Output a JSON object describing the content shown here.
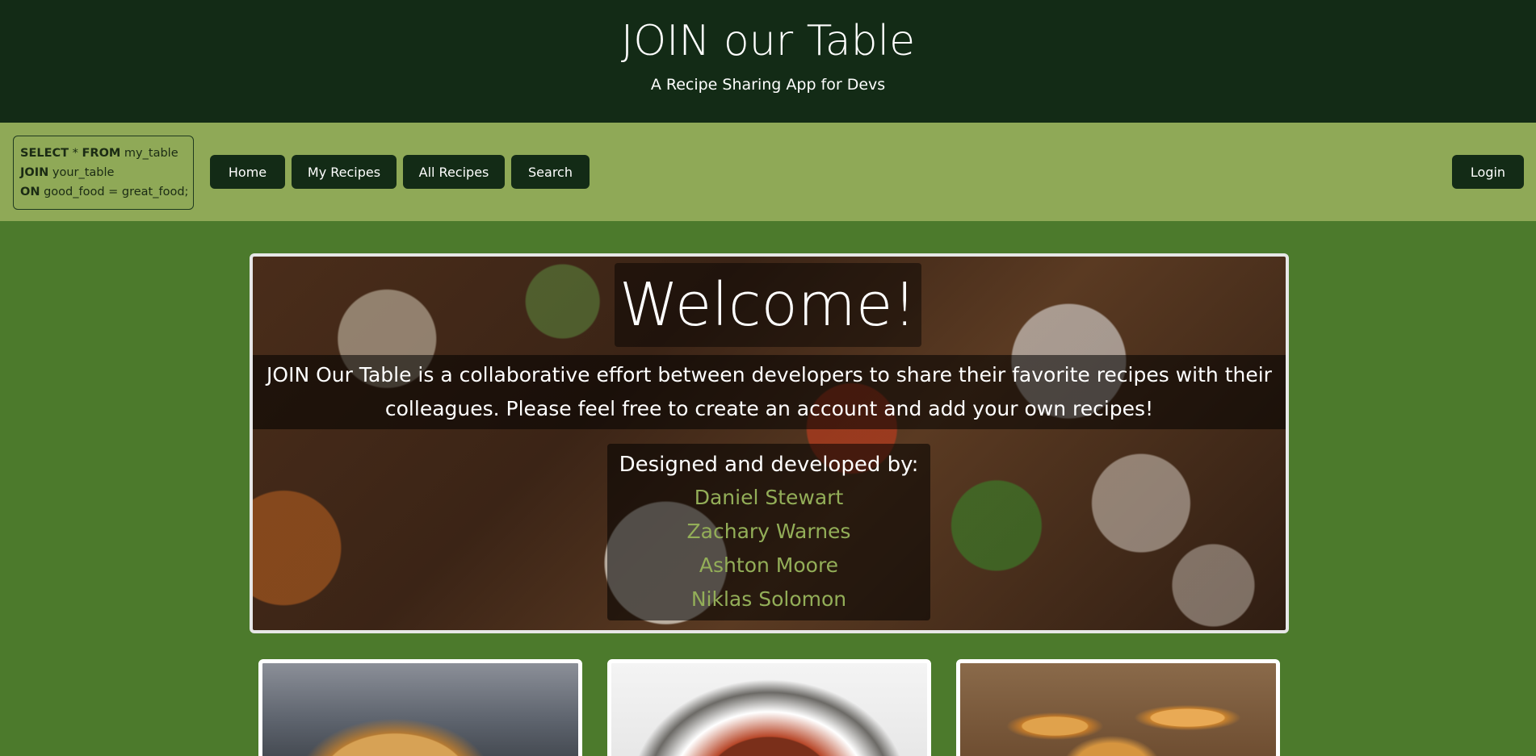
{
  "header": {
    "title": "JOIN our Table",
    "subtitle": "A Recipe Sharing App for Devs"
  },
  "logo": {
    "line1_kw": "SELECT",
    "line1_mid": " * ",
    "line1_kw2": "FROM",
    "line1_rest": " my_table",
    "line2_kw": "JOIN",
    "line2_rest": " your_table",
    "line3_kw": "ON",
    "line3_rest": " good_food = great_food;"
  },
  "nav": {
    "home": "Home",
    "my_recipes": "My Recipes",
    "all_recipes": "All Recipes",
    "search": "Search",
    "login": "Login"
  },
  "hero": {
    "welcome": "Welcome!",
    "description": "JOIN Our Table is a collaborative effort between developers to share their favorite recipes with their colleagues. Please feel free to create an account and add your own recipes!",
    "devs_heading": "Designed and developed by:",
    "developers": [
      "Daniel Stewart",
      "Zachary Warnes",
      "Ashton Moore",
      "Niklas Solomon"
    ]
  },
  "cards": [
    {
      "image": "pancakes-photo"
    },
    {
      "image": "bowl-photo"
    },
    {
      "image": "roast-chicken-photo"
    }
  ],
  "colors": {
    "header_bg": "#132b16",
    "nav_bg": "#8fa957",
    "page_bg": "#4c7a2c",
    "button_bg": "#132b16",
    "dev_name": "#93ae58"
  }
}
